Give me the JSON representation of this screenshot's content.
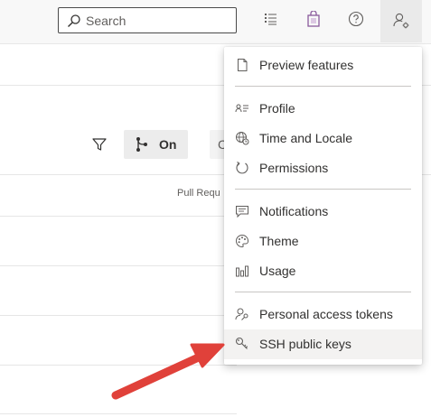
{
  "header": {
    "search": {
      "placeholder": "Search",
      "value": ""
    },
    "icons": [
      "search-icon",
      "task-list-icon",
      "shopping-bag-icon",
      "help-icon",
      "user-settings-icon"
    ]
  },
  "content": {
    "toolbar": {
      "filter_icon": "filter-icon",
      "branch_toggle_label": "On",
      "partial_button_label": "C"
    },
    "table": {
      "column_header": "Pull Requ"
    }
  },
  "user_menu": {
    "groups": [
      [
        {
          "label": "Preview features",
          "icon": "document-icon"
        }
      ],
      [
        {
          "label": "Profile",
          "icon": "contact-card-icon"
        },
        {
          "label": "Time and Locale",
          "icon": "globe-clock-icon"
        },
        {
          "label": "Permissions",
          "icon": "permissions-icon"
        }
      ],
      [
        {
          "label": "Notifications",
          "icon": "chat-icon"
        },
        {
          "label": "Theme",
          "icon": "palette-icon"
        },
        {
          "label": "Usage",
          "icon": "bar-chart-icon"
        }
      ],
      [
        {
          "label": "Personal access tokens",
          "icon": "person-key-icon"
        },
        {
          "label": "SSH public keys",
          "icon": "ssh-key-icon",
          "highlighted": true
        }
      ]
    ]
  },
  "annotation": {
    "type": "arrow",
    "color": "#e0413a",
    "points_to": "SSH public keys"
  }
}
